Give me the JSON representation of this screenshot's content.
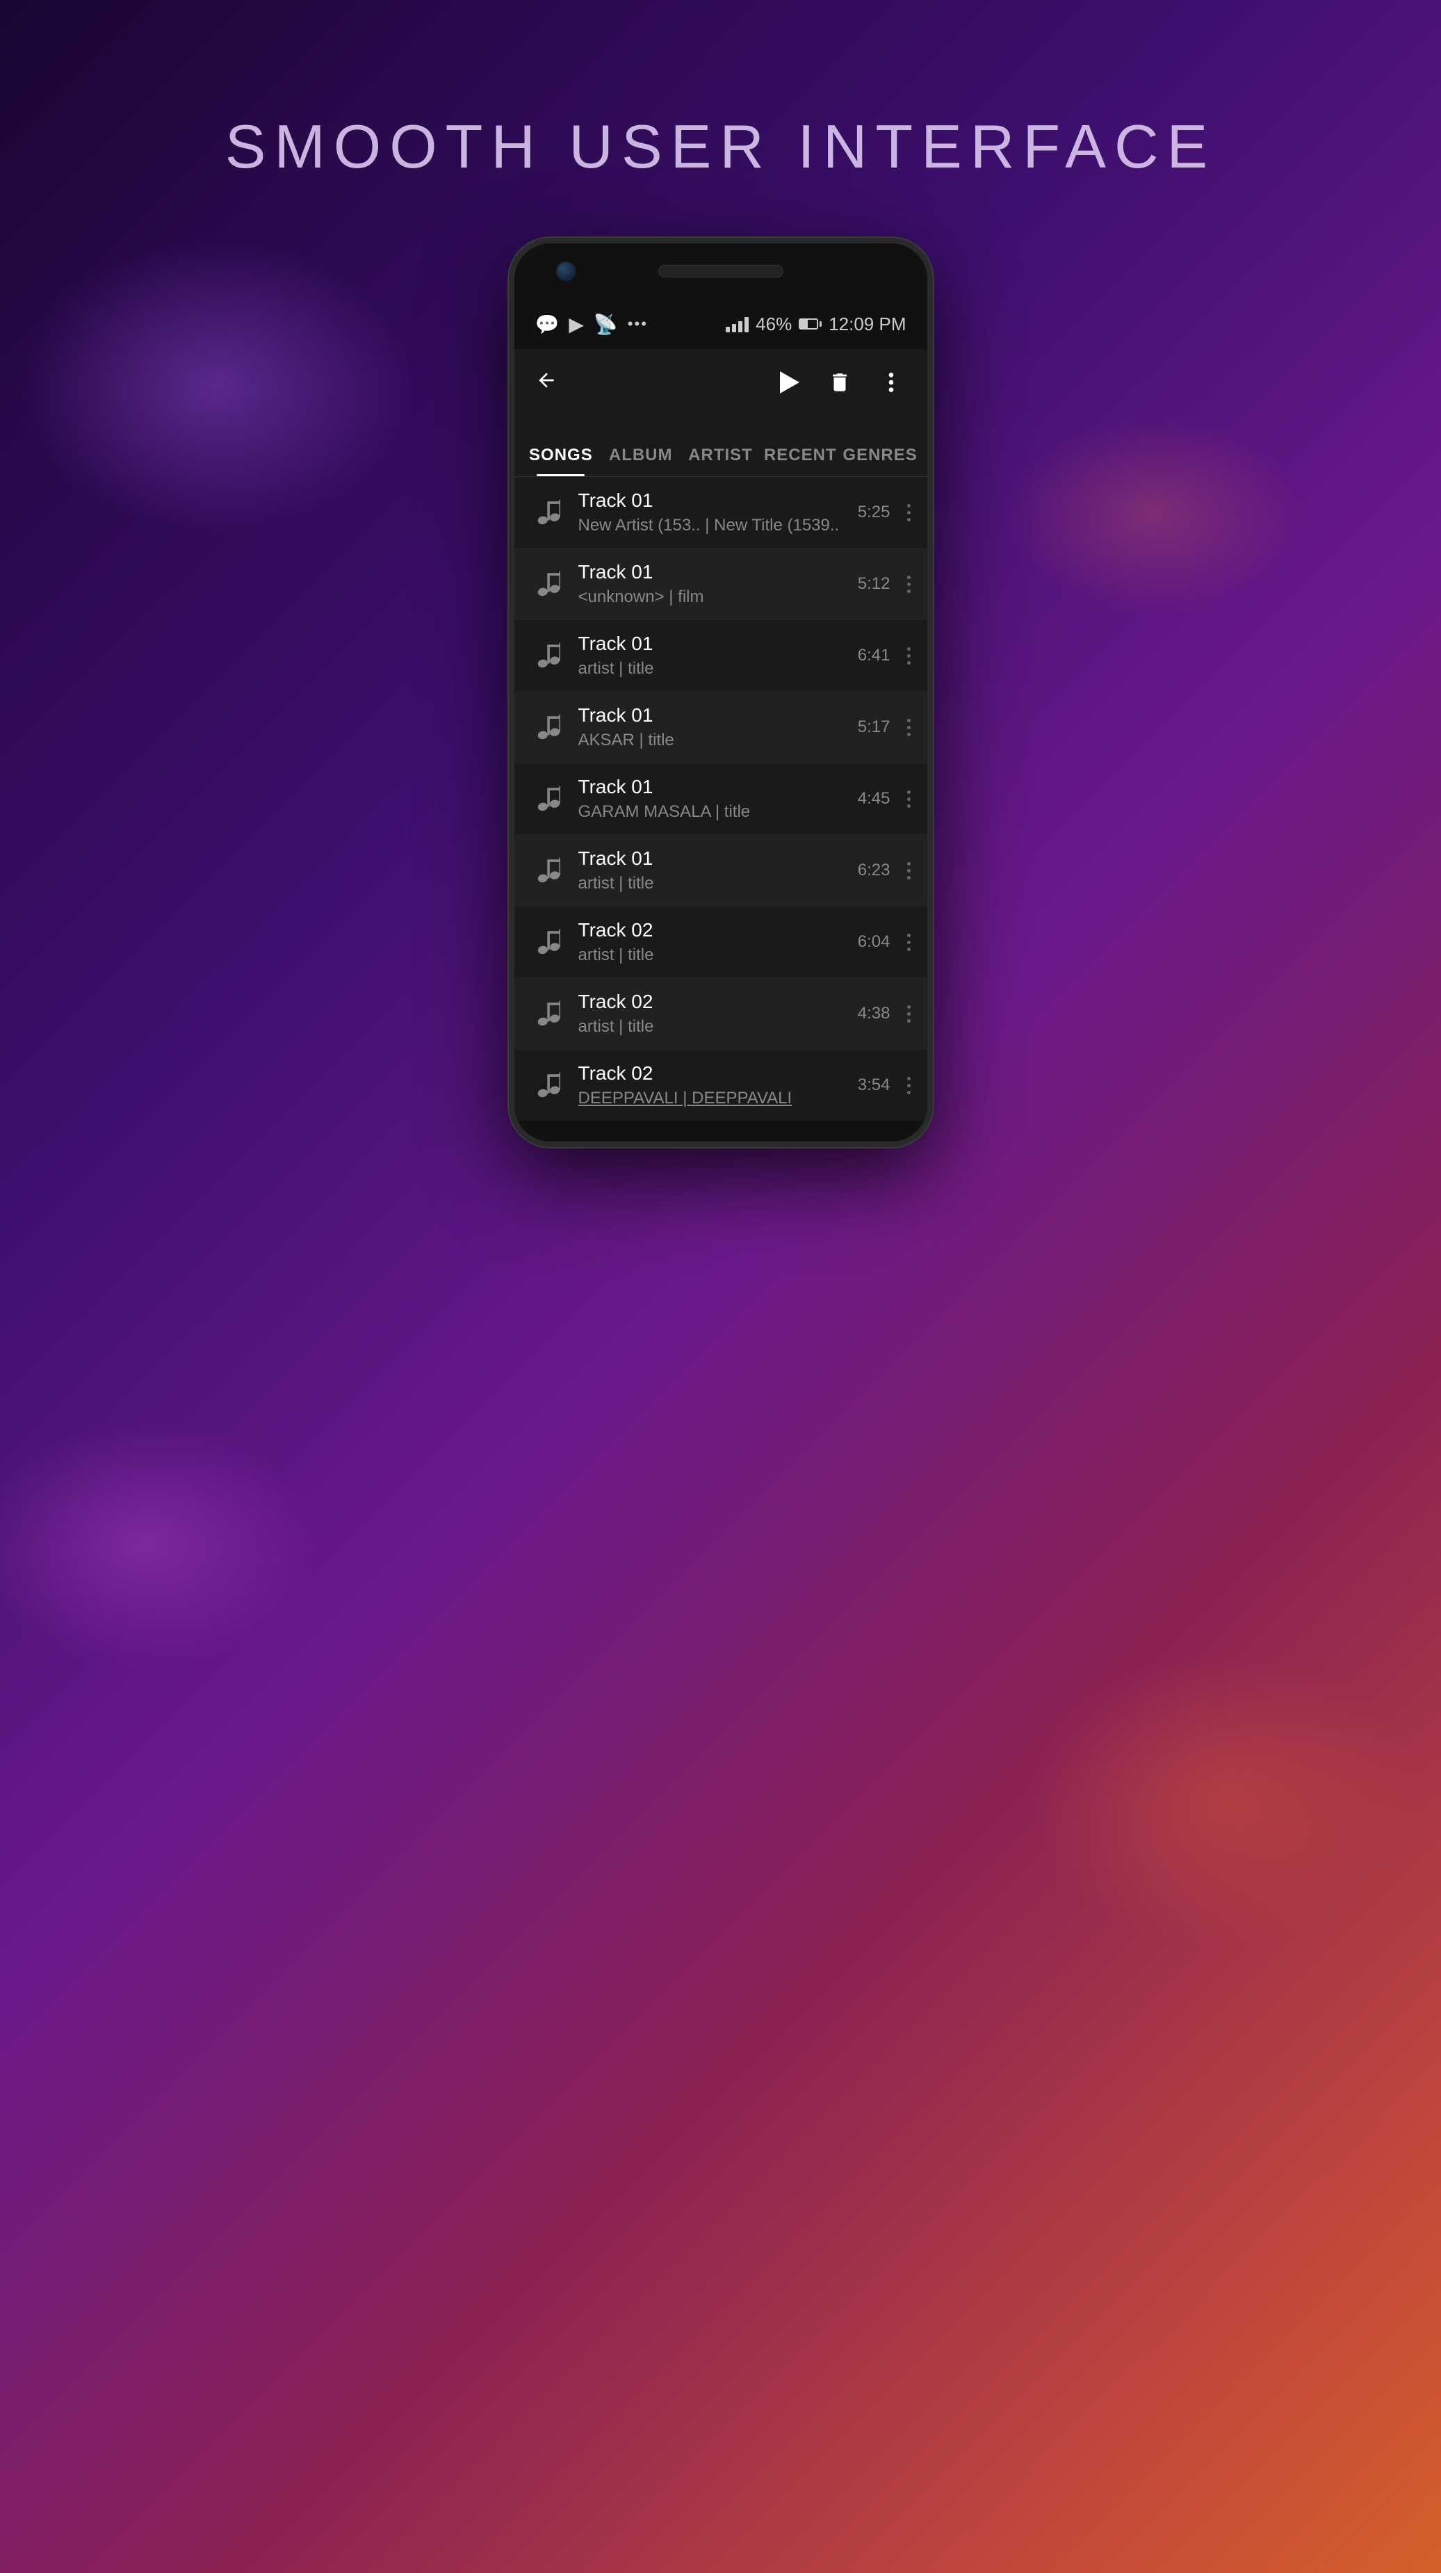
{
  "page": {
    "headline": "SMOOTH USER INTERFACE"
  },
  "status_bar": {
    "icons": [
      "whatsapp",
      "media",
      "cast",
      "dots"
    ],
    "signal": "4 bars",
    "battery_percent": "46%",
    "time": "12:09 PM"
  },
  "tabs": [
    {
      "id": "songs",
      "label": "SONGS",
      "active": true
    },
    {
      "id": "album",
      "label": "ALBUM",
      "active": false
    },
    {
      "id": "artist",
      "label": "ARTIST",
      "active": false
    },
    {
      "id": "recent",
      "label": "RECENT",
      "active": false
    },
    {
      "id": "genres",
      "label": "GENRES",
      "active": false
    }
  ],
  "tracks": [
    {
      "id": 1,
      "name": "Track 01",
      "artist": "New Artist (153..",
      "title": "New Title (1539..",
      "subtitle": "New Artist (153.. | New Title (1539..",
      "duration": "5:25",
      "alt": false
    },
    {
      "id": 2,
      "name": "Track 01",
      "artist": "<unknown>",
      "title": "film",
      "subtitle": "<unknown> | film",
      "duration": "5:12",
      "alt": true
    },
    {
      "id": 3,
      "name": "Track 01",
      "artist": "artist",
      "title": "title",
      "subtitle": "artist | title",
      "duration": "6:41",
      "alt": false
    },
    {
      "id": 4,
      "name": "Track 01",
      "artist": "AKSAR",
      "title": "title",
      "subtitle": "AKSAR | title",
      "duration": "5:17",
      "alt": true
    },
    {
      "id": 5,
      "name": "Track 01",
      "artist": "GARAM MASALA",
      "title": "title",
      "subtitle": "GARAM MASALA | title",
      "duration": "4:45",
      "alt": false
    },
    {
      "id": 6,
      "name": "Track 01",
      "artist": "artist",
      "title": "title",
      "subtitle": "artist | title",
      "duration": "6:23",
      "alt": true
    },
    {
      "id": 7,
      "name": "Track 02",
      "artist": "artist",
      "title": "title",
      "subtitle": "artist | title",
      "duration": "6:04",
      "alt": false
    },
    {
      "id": 8,
      "name": "Track 02",
      "artist": "artist",
      "title": "title",
      "subtitle": "artist | title",
      "duration": "4:38",
      "alt": true
    },
    {
      "id": 9,
      "name": "Track 02",
      "artist": "DEEPPAVALI",
      "title": "DEEPPAVALI",
      "subtitle": "DEEPPAVALI | DEEPPAVALI",
      "duration": "3:54",
      "alt": false
    }
  ]
}
